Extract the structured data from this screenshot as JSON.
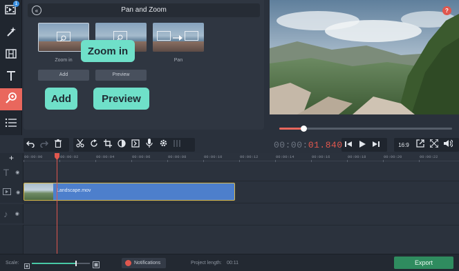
{
  "panel": {
    "title": "Pan and Zoom",
    "effects": [
      {
        "label": "Zoom in"
      },
      {
        "label": ""
      },
      {
        "label": "Pan"
      }
    ],
    "add_label": "Add",
    "preview_label": "Preview"
  },
  "callouts": {
    "zoom_in": "Zoom in",
    "add": "Add",
    "preview": "Preview"
  },
  "help_label": "?",
  "notification_count": "1",
  "scrubber_progress": 0.14,
  "timecode": {
    "dim": "00:00:",
    "red": "01.840"
  },
  "aspect_ratio": "16:9",
  "timeline": {
    "ruler": [
      "00:00:00",
      "00:00:02",
      "00:00:04",
      "00:00:06",
      "00:00:08",
      "00:00:10",
      "00:00:12",
      "00:00:14",
      "00:00:16",
      "00:00:18",
      "00:00:20",
      "00:00:22"
    ],
    "clip_name": "Landscape.mov"
  },
  "status": {
    "scale_label": "Scale:",
    "scale_level": 0.75,
    "notifications_label": "Notifications",
    "project_length_label": "Project length:",
    "project_length_value": "00:11",
    "export_label": "Export"
  },
  "colors": {
    "accent": "#e9675d",
    "callout": "#6fe0c9",
    "clip": "#4d7fcc",
    "export": "#2f8c5f"
  }
}
